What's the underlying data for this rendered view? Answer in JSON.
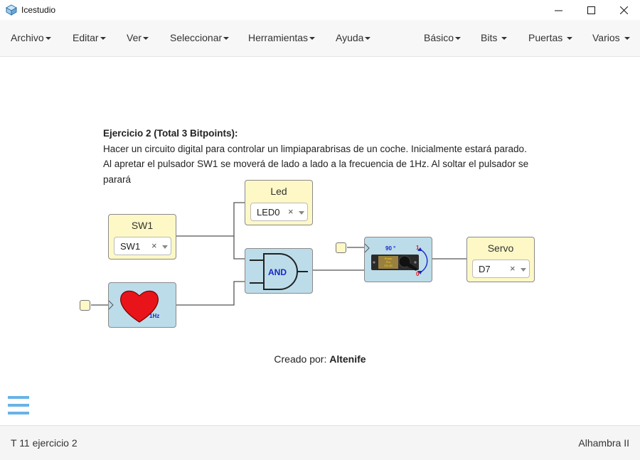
{
  "window": {
    "title": "Icestudio"
  },
  "menu_left": [
    "Archivo",
    "Editar",
    "Ver",
    "Seleccionar",
    "Herramientas",
    "Ayuda"
  ],
  "menu_right": [
    "Básico",
    "Bits",
    "Puertas",
    "Varios"
  ],
  "info": {
    "heading": "Ejercicio 2 (Total 3 Bitpoints):",
    "line1": "Hacer un circuito digital para controlar un limpiaparabrisas de un coche. Inicialmente estará parado.",
    "line2": "Al apretar el pulsador SW1 se moverá de lado a lado a la frecuencia de 1Hz. Al soltar el pulsador se",
    "line3": "parará"
  },
  "blocks": {
    "sw1": {
      "label": "SW1",
      "value": "SW1"
    },
    "led": {
      "label": "Led",
      "value": "LED0"
    },
    "servo": {
      "label": "Servo",
      "value": "D7"
    },
    "and_gate": {
      "label": "AND"
    },
    "heart": {
      "label": "1Hz"
    },
    "servo_motor": {
      "angle": "90 °",
      "top": "1",
      "bottom": "0",
      "brand": [
        "Emax",
        "Pro",
        "SG-90"
      ]
    }
  },
  "credit": {
    "prefix": "Creado por: ",
    "author": "Altenife"
  },
  "footer": {
    "file": "T 11 ejercicio 2",
    "board": "Alhambra II"
  },
  "colors": {
    "block_yellow": "#fdf8c6",
    "block_blue": "#bcdce9",
    "heart_red": "#e8141a",
    "and_text": "#1726c8",
    "hamburger": "#69b3e7"
  }
}
